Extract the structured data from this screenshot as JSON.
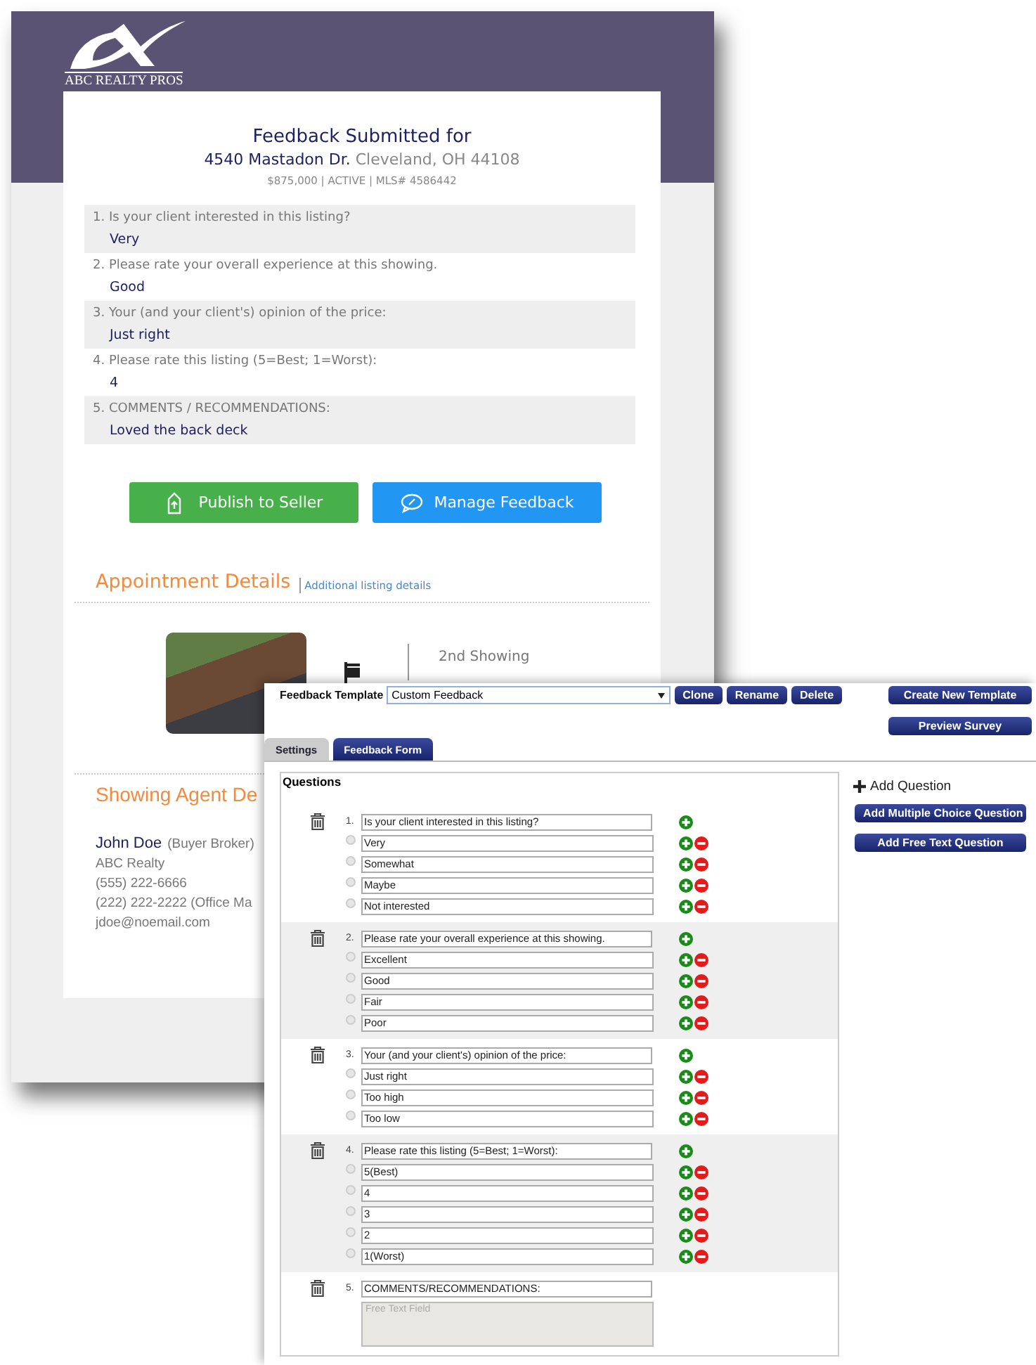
{
  "report_window": {
    "logo_text": "ABC REALTY PROS",
    "title": "Feedback Submitted for",
    "street": "4540 Mastadon Dr.",
    "city": "Cleveland, OH 44108",
    "listing_meta": "$875,000 | ACTIVE | MLS# 4586442",
    "answers": [
      {
        "question": "1. Is your client interested in this listing?",
        "answer": "Very"
      },
      {
        "question": "2. Please rate your overall experience at this showing.",
        "answer": "Good"
      },
      {
        "question": "3. Your (and your client's) opinion of the price:",
        "answer": "Just right"
      },
      {
        "question": "4. Please rate this listing (5=Best; 1=Worst):",
        "answer": "4"
      },
      {
        "question": "5. COMMENTS / RECOMMENDATIONS:",
        "answer": "Loved the back deck"
      }
    ],
    "buttons": [
      {
        "label": "Publish to Seller",
        "kind": "publish"
      },
      {
        "label": "Manage Feedback",
        "kind": "manage"
      }
    ],
    "appointment": {
      "heading": "Appointment Details",
      "link": "Additional listing details",
      "showing": "2nd Showing"
    },
    "agent": {
      "heading": "Showing Agent De",
      "name": "John Doe",
      "role": "(Buyer Broker)",
      "company": "ABC Realty",
      "phone": "(555) 222-6666",
      "phone_2": "(222) 222-2222 (Office Ma",
      "email": "jdoe@noemail.com"
    }
  },
  "template_window": {
    "template_label": "Feedback Template",
    "template_value": "Custom Feedback",
    "buttons": [
      "Clone",
      "Rename",
      "Delete"
    ],
    "side_buttons": [
      "Create New Template",
      "Preview Survey"
    ],
    "tabs": [
      {
        "label": "Settings",
        "selected": false
      },
      {
        "label": "Feedback Form",
        "selected": true
      }
    ],
    "questions_title": "Questions",
    "questions": [
      {
        "number": "1.",
        "text": "Is your client interested in this listing?",
        "kind": "choice",
        "options": [
          {
            "label": "Very",
            "selected": false
          },
          {
            "label": "Somewhat",
            "selected": false
          },
          {
            "label": "Maybe",
            "selected": false
          },
          {
            "label": "Not interested",
            "selected": false
          }
        ]
      },
      {
        "number": "2.",
        "text": "Please rate your overall experience at this showing.",
        "kind": "choice",
        "options": [
          {
            "label": "Excellent",
            "selected": false
          },
          {
            "label": "Good",
            "selected": false
          },
          {
            "label": "Fair",
            "selected": false
          },
          {
            "label": "Poor",
            "selected": false
          }
        ]
      },
      {
        "number": "3.",
        "text": "Your (and your client's) opinion of the price:",
        "kind": "choice",
        "options": [
          {
            "label": "Just right",
            "selected": false
          },
          {
            "label": "Too high",
            "selected": false
          },
          {
            "label": "Too low",
            "selected": false
          }
        ]
      },
      {
        "number": "4.",
        "text": "Please rate this listing (5=Best; 1=Worst):",
        "kind": "choice",
        "options": [
          {
            "label": "5(Best)",
            "selected": false
          },
          {
            "label": "4",
            "selected": false
          },
          {
            "label": "3",
            "selected": false
          },
          {
            "label": "2",
            "selected": false
          },
          {
            "label": "1(Worst)",
            "selected": false
          }
        ]
      },
      {
        "number": "5.",
        "text": "COMMENTS/RECOMMENDATIONS:",
        "kind": "text",
        "placeholder": "Free Text Field"
      }
    ],
    "add_question": "Add Question",
    "add_buttons": [
      "Add Multiple Choice Question",
      "Add Free Text Question"
    ]
  }
}
